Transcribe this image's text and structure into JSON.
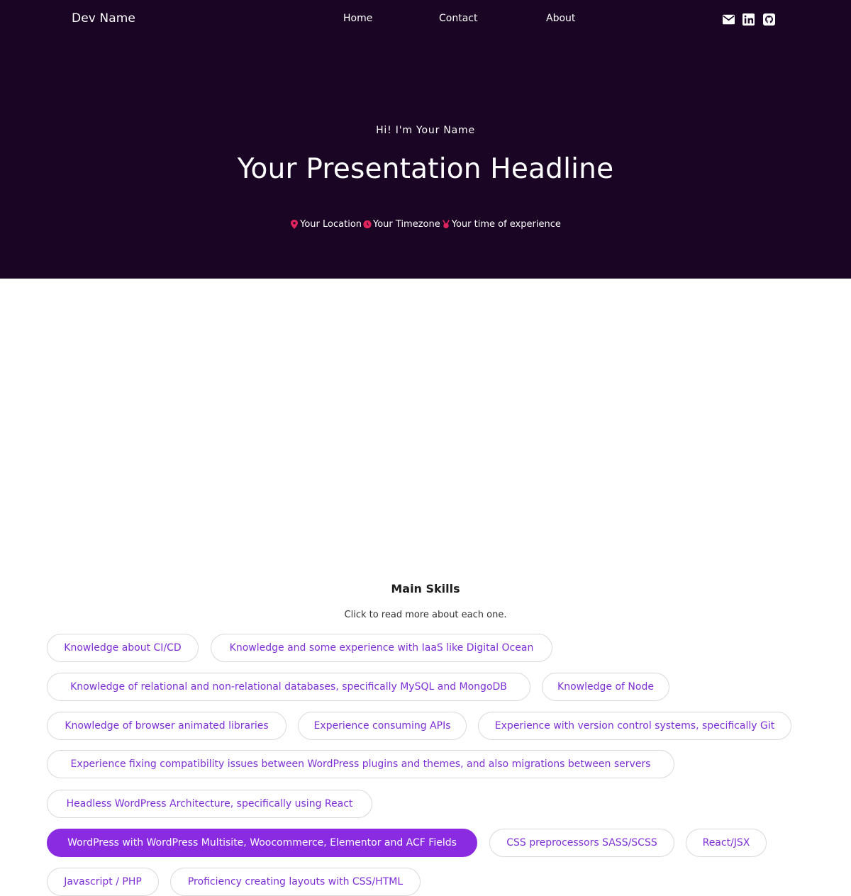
{
  "header": {
    "brand": "Dev Name",
    "nav": [
      "Home",
      "Contact",
      "About"
    ],
    "social_icons": [
      "envelope-icon",
      "linkedin-icon",
      "github-icon"
    ]
  },
  "hero": {
    "greeting": "Hi! I'm Your Name",
    "headline": "Your Presentation Headline",
    "meta": [
      {
        "icon": "location-pin-icon",
        "text": "Your Location"
      },
      {
        "icon": "clock-icon",
        "text": "Your Timezone"
      },
      {
        "icon": "medal-icon",
        "text": "Your time of experience"
      }
    ]
  },
  "skills": {
    "title": "Main Skills",
    "subtitle": "Click to read more about each one.",
    "items": [
      "Knowledge about CI/CD",
      "Knowledge and some experience with IaaS like Digital Ocean",
      "Knowledge of relational and non-relational databases, specifically MySQL and MongoDB",
      "Knowledge of Node",
      "Knowledge of browser animated libraries",
      "Experience consuming APIs",
      "Experience with version control systems, specifically Git",
      "Experience fixing compatibility issues between WordPress plugins and themes, and also migrations between servers",
      "Headless WordPress Architecture, specifically using React",
      "WordPress with WordPress Multisite, Woocommerce, Elementor and ACF Fields",
      "CSS preprocessors SASS/SCSS",
      "React/JSX",
      "Javascript / PHP",
      "Proficiency creating layouts with CSS/HTML"
    ],
    "active_item": "WordPress with WordPress Multisite, Woocommerce, Elementor and ACF Fields"
  },
  "colors": {
    "hero_bg": "#1a0525",
    "accent": "#8a2be2",
    "pill_text": "#7e2fd6",
    "icon_red": "#e0245e"
  }
}
